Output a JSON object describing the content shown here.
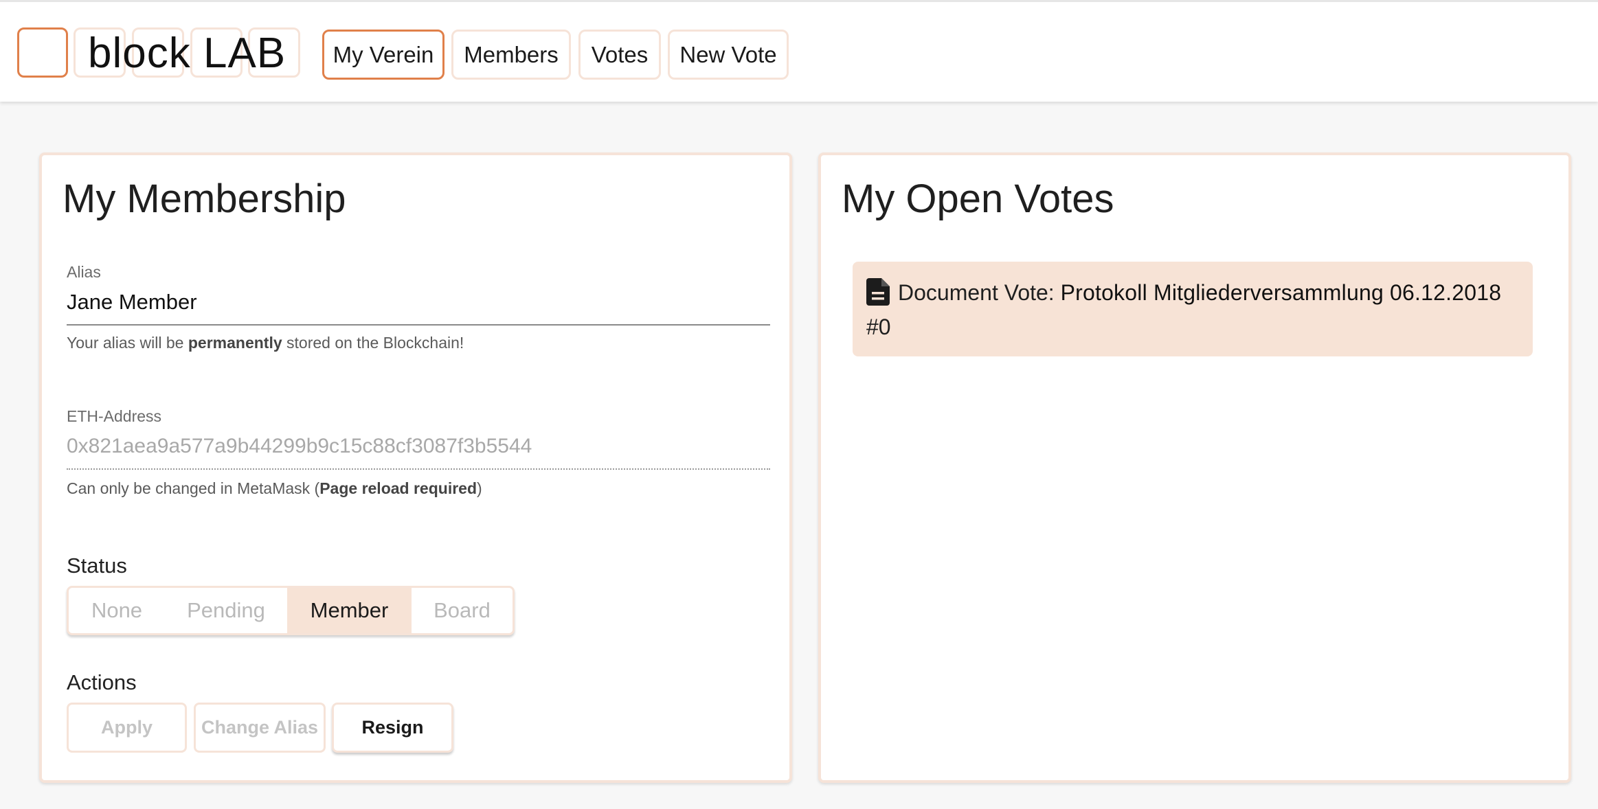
{
  "app": {
    "logo_text": "block LAB"
  },
  "nav": {
    "items": [
      {
        "label": "My Verein",
        "active": true
      },
      {
        "label": "Members",
        "active": false
      },
      {
        "label": "Votes",
        "active": false
      },
      {
        "label": "New Vote",
        "active": false
      }
    ]
  },
  "membership": {
    "title": "My Membership",
    "alias": {
      "label": "Alias",
      "value": "Jane Member",
      "hint_prefix": "Your alias will be ",
      "hint_bold": "permanently",
      "hint_suffix": " stored on the Blockchain!"
    },
    "eth": {
      "label": "ETH-Address",
      "value": "0x821aea9a577a9b44299b9c15c88cf3087f3b5544",
      "hint_prefix": "Can only be changed in MetaMask (",
      "hint_bold": "Page reload required",
      "hint_suffix": ")"
    },
    "status": {
      "label": "Status",
      "options": [
        "None",
        "Pending",
        "Member",
        "Board"
      ],
      "selected": "Member"
    },
    "actions": {
      "label": "Actions",
      "buttons": [
        {
          "label": "Apply",
          "enabled": false
        },
        {
          "label": "Change Alias",
          "enabled": false
        },
        {
          "label": "Resign",
          "enabled": true
        }
      ]
    }
  },
  "open_votes": {
    "title": "My Open Votes",
    "items": [
      {
        "icon": "document-icon",
        "type_label": "Document Vote: ",
        "title": "Protokoll Mitgliederversammlung 06.12.2018",
        "id": "#0"
      }
    ]
  },
  "colors": {
    "accent": "#e0804a",
    "accent_light": "#f6e3d8",
    "selected_bg": "#f7e3d6"
  }
}
